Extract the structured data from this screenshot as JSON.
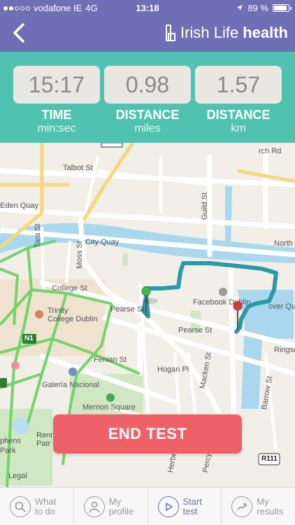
{
  "status_bar": {
    "carrier": "vodafone IE",
    "network": "4G",
    "time": "13:18",
    "battery": "89 %",
    "battery_level": 0.89
  },
  "header": {
    "brand_light": "Irish Life",
    "brand_bold": "health"
  },
  "stats": [
    {
      "value": "15:17",
      "label": "TIME",
      "unit": "min:sec"
    },
    {
      "value": "0.98",
      "label": "DISTANCE",
      "unit": "miles"
    },
    {
      "value": "1.57",
      "label": "DISTANCE",
      "unit": "km"
    }
  ],
  "map": {
    "labels": {
      "talbot_st": "Talbot St",
      "eden_quay": "Eden Quay",
      "city_quay": "City Quay",
      "tara_st": "Tara St",
      "moss_st": "Moss St",
      "guild_st": "Guild St",
      "north_w": "North W",
      "college_st": "College St",
      "pearse_st": "Pearse St",
      "pearse_st_2": "Pearse St",
      "trinity": "Trinity",
      "college_dublin": "College Dublin",
      "facebook_dublin": "Facebook Dublin",
      "grover_quay": "over Qua",
      "ringsend": "Ringse",
      "fenian_st": "Fenian St",
      "hogan_pl": "Hogan Pl",
      "mackan_st": "Macken St",
      "barrow_st": "Barrow St",
      "galeria": "Galería Nacional",
      "merrion": "Merrion Square",
      "phens": "phens",
      "park": "Park",
      "renn": "Renn",
      "patr": "Patr",
      "herbert": "Herbert St",
      "percy": "Percy Pl",
      "legal": "Legal",
      "church_rd": "rch Rd",
      "n1": "N1",
      "r111": "R111"
    }
  },
  "end_button": "END TEST",
  "bottom_nav": [
    {
      "line1": "What",
      "line2": "to do",
      "icon": "search-icon"
    },
    {
      "line1": "My",
      "line2": "profile",
      "icon": "person-icon"
    },
    {
      "line1": "Start",
      "line2": "test",
      "icon": "play-icon"
    },
    {
      "line1": "My",
      "line2": "results",
      "icon": "trend-icon"
    }
  ],
  "colors": {
    "header": "#6e6fb4",
    "stats_bg": "#4fc3b0",
    "end_button": "#ef6169",
    "route": "#2a9aa8",
    "start_pin": "#3cbf4a",
    "end_pin": "#e53935"
  }
}
